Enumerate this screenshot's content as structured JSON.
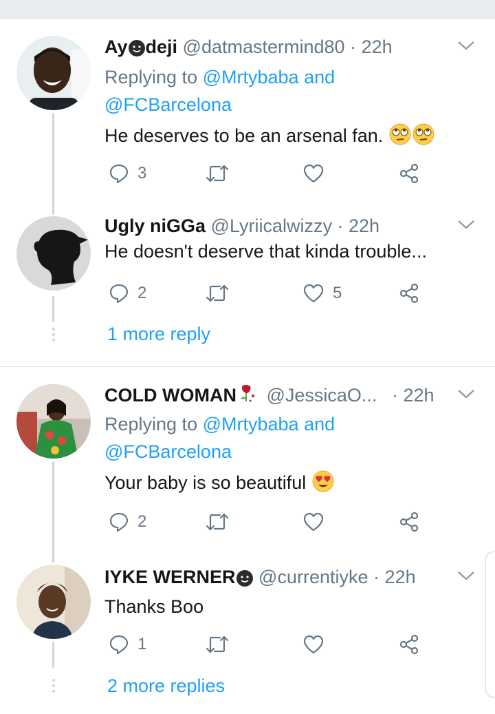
{
  "tweets": [
    {
      "name": "Ay",
      "name_suffix": "deji",
      "handle": "@datmastermind80",
      "sep": "·",
      "time": "22h",
      "replying_prefix": "Replying to",
      "replying_user1": "@Mrtybaba",
      "replying_and": "and",
      "replying_user2": "@FCBarcelona",
      "text": "He deserves to be an arsenal fan.",
      "reply_count": "3",
      "retweet_count": "",
      "like_count": ""
    },
    {
      "name": "Ugly niGGa",
      "handle": "@Lyriicalwizzy",
      "sep": "·",
      "time": "22h",
      "text": "He doesn't deserve that kinda trouble...",
      "reply_count": "2",
      "retweet_count": "",
      "like_count": "5"
    },
    {
      "name": "COLD WOMAN",
      "handle": "@JessicaO...",
      "sep": "·",
      "time": "22h",
      "replying_prefix": "Replying to",
      "replying_user1": "@Mrtybaba",
      "replying_and": "and",
      "replying_user2": "@FCBarcelona",
      "text": "Your baby is so beautiful",
      "reply_count": "2",
      "retweet_count": "",
      "like_count": ""
    },
    {
      "name": "IYKE WERNER",
      "handle": "@currentiyke",
      "sep": "·",
      "time": "22h",
      "text": "Thanks Boo",
      "reply_count": "1",
      "retweet_count": "",
      "like_count": ""
    }
  ],
  "more_replies_1": "1 more reply",
  "more_replies_2": "2 more replies",
  "colors": {
    "link": "#1da1f2",
    "secondary_text": "#657786",
    "primary_text": "#14171a",
    "divider": "#e1e8ed"
  },
  "icons": [
    "reply-icon",
    "retweet-icon",
    "like-icon",
    "share-icon",
    "chevron-down-icon",
    "face-emoji-icon",
    "rose-emoji-icon",
    "eye-roll-emoji-icon",
    "heart-eyes-emoji-icon"
  ]
}
